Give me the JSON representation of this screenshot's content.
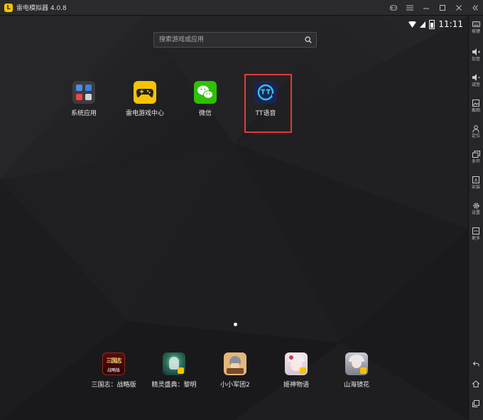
{
  "window": {
    "title": "雷电模拟器 4.0.8",
    "logo_text": "L"
  },
  "status": {
    "time": "11:11"
  },
  "search": {
    "placeholder": "搜索游戏或应用"
  },
  "apps": [
    {
      "id": "system-apps",
      "label": "系统应用"
    },
    {
      "id": "leidian-game-center",
      "label": "雷电游戏中心"
    },
    {
      "id": "wechat",
      "label": "微信"
    },
    {
      "id": "tt-voice",
      "label": "TT语音"
    }
  ],
  "dock": [
    {
      "id": "sanguozhi",
      "label": "三国志：战略版",
      "icon_text": "三国志",
      "icon_sub": "战略版"
    },
    {
      "id": "jingling",
      "label": "精灵盛典：黎明"
    },
    {
      "id": "xiaoxiaojuntuan",
      "label": "小小军团2"
    },
    {
      "id": "jishen",
      "label": "姬神物语"
    },
    {
      "id": "shanhai",
      "label": "山海镜花"
    }
  ],
  "sidebar": [
    {
      "id": "keys",
      "label": "按键"
    },
    {
      "id": "vol-up",
      "label": "加音"
    },
    {
      "id": "vol-down",
      "label": "减音"
    },
    {
      "id": "screenshot",
      "label": "截图"
    },
    {
      "id": "location",
      "label": "定位"
    },
    {
      "id": "multi",
      "label": "多开"
    },
    {
      "id": "install",
      "label": "安装"
    },
    {
      "id": "settings",
      "label": "设置"
    },
    {
      "id": "more",
      "label": "更多"
    }
  ]
}
